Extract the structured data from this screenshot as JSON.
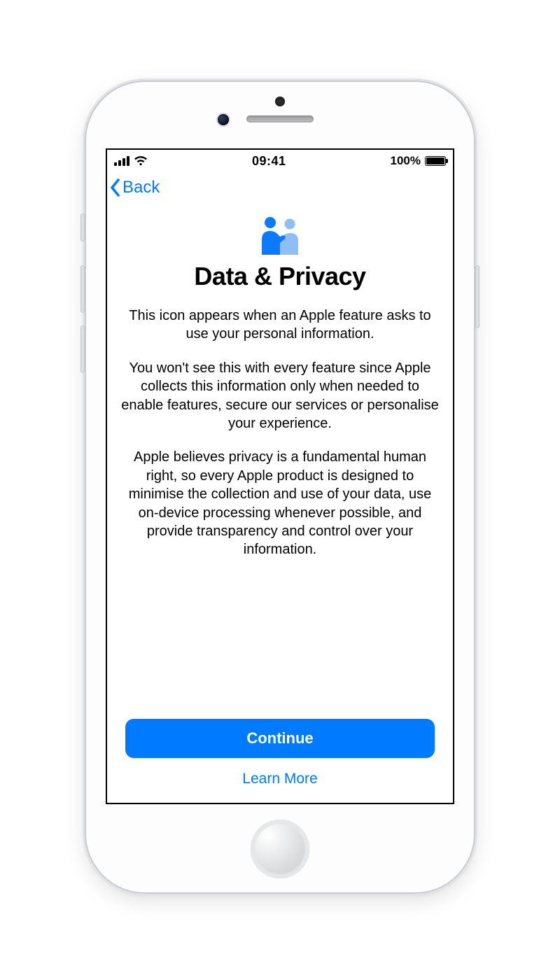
{
  "statusbar": {
    "time": "09:41",
    "battery_pct": "100%"
  },
  "nav": {
    "back_label": "Back"
  },
  "page": {
    "title": "Data & Privacy",
    "paragraphs": [
      "This icon appears when an Apple feature asks to use your personal information.",
      "You won't see this with every feature since Apple collects this information only when needed to enable features, secure our services or personalise your experience.",
      "Apple believes privacy is a fundamental human right, so every Apple product is designed to minimise the collection and use of your data, use on-device processing whenever possible, and provide transparency and control over your information."
    ]
  },
  "actions": {
    "continue_label": "Continue",
    "learn_more_label": "Learn More"
  },
  "colors": {
    "accent": "#007aff"
  }
}
